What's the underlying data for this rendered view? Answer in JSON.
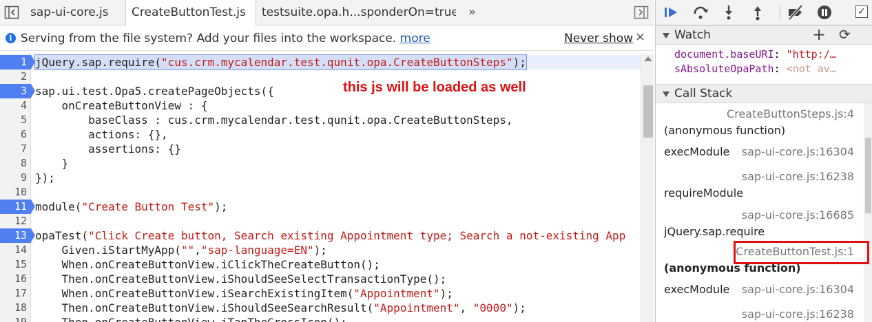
{
  "tabs": [
    {
      "label": "sap-ui-core.js"
    },
    {
      "label": "CreateButtonTest.js"
    },
    {
      "label": "testsuite.opa.h...sponderOn=true"
    }
  ],
  "tab_overflow": "»",
  "infobar": {
    "text": "Serving from the file system? Add your files into the workspace.",
    "link": "more",
    "never_show": "Never show",
    "close": "×"
  },
  "code_lines": [
    {
      "n": "1",
      "text": "jQuery.sap.require(\"cus.crm.mycalendar.test.qunit.opa.CreateButtonSteps\");"
    },
    {
      "n": "2",
      "text": ""
    },
    {
      "n": "3",
      "text": "sap.ui.test.Opa5.createPageObjects({"
    },
    {
      "n": "4",
      "text": "    onCreateButtonView : {"
    },
    {
      "n": "5",
      "text": "        baseClass : cus.crm.mycalendar.test.qunit.opa.CreateButtonSteps,"
    },
    {
      "n": "6",
      "text": "        actions: {},"
    },
    {
      "n": "7",
      "text": "        assertions: {}"
    },
    {
      "n": "8",
      "text": "    }"
    },
    {
      "n": "9",
      "text": "});"
    },
    {
      "n": "10",
      "text": ""
    },
    {
      "n": "11",
      "text": "module(\"Create Button Test\");"
    },
    {
      "n": "12",
      "text": ""
    },
    {
      "n": "13",
      "text": "opaTest(\"Click Create button, Search existing Appointment type; Search a not-existing App"
    },
    {
      "n": "14",
      "text": "    Given.iStartMyApp(\"\",\"sap-language=EN\");"
    },
    {
      "n": "15",
      "text": "    When.onCreateButtonView.iClickTheCreateButton();"
    },
    {
      "n": "16",
      "text": "    Then.onCreateButtonView.iShouldSeeSelectTransactionType();"
    },
    {
      "n": "17",
      "text": "    When.onCreateButtonView.iSearchExistingItem(\"Appointment\");"
    },
    {
      "n": "18",
      "text": "    Then.onCreateButtonView.iShouldSeeSearchResult(\"Appointment\", \"0000\");"
    },
    {
      "n": "19",
      "text": "    Then.onCreateButtonView.iTapTheCrossIcon();"
    }
  ],
  "breakpoint_lines": [
    "1",
    "3",
    "11",
    "13"
  ],
  "annotation": "this js will be loaded as well",
  "watch": {
    "title": "Watch",
    "items": [
      {
        "name": "document.baseURI",
        "value": "\"http:/…"
      },
      {
        "name": "sAbsoluteOpaPath",
        "value": "<not av…"
      }
    ]
  },
  "call_stack": {
    "title": "Call Stack",
    "frames": [
      {
        "fn": "(anonymous function)",
        "loc": "CreateButtonSteps.js:4"
      },
      {
        "fn": "execModule",
        "loc": "sap-ui-core.js:16304"
      },
      {
        "fn": "requireModule",
        "loc": "sap-ui-core.js:16238"
      },
      {
        "fn": "jQuery.sap.require",
        "loc": "sap-ui-core.js:16685"
      },
      {
        "fn": "(anonymous function)",
        "loc": "CreateButtonTest.js:1"
      },
      {
        "fn": "execModule",
        "loc": "sap-ui-core.js:16304"
      },
      {
        "fn": "",
        "loc": "sap-ui-core.js:16238"
      }
    ]
  },
  "colors": {
    "breakpoint": "#4f7ff0",
    "annotation": "#e01010",
    "string": "#c41a16",
    "debugger_accent": "#3b6fd8"
  }
}
